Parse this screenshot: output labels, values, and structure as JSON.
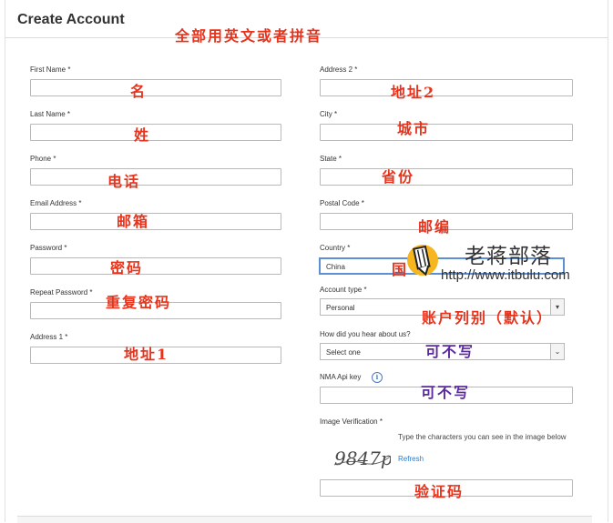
{
  "page": {
    "title": "Create Account"
  },
  "annotations": {
    "top": "全部用英文或者拼音",
    "first_name": "名",
    "last_name": "姓",
    "phone": "电话",
    "email": "邮箱",
    "password": "密码",
    "repeat_password": "重复密码",
    "address1": "地址1",
    "address2": "地址2",
    "city": "城市",
    "state": "省份",
    "postal": "邮编",
    "country": "国",
    "account_type": "账户列别（默认）",
    "hear": "可不写",
    "api_key": "可不写",
    "captcha": "验证码"
  },
  "form": {
    "first_name_label": "First Name *",
    "last_name_label": "Last Name *",
    "phone_label": "Phone *",
    "email_label": "Email Address *",
    "password_label": "Password *",
    "repeat_password_label": "Repeat Password *",
    "address1_label": "Address 1 *",
    "address2_label": "Address 2 *",
    "city_label": "City *",
    "state_label": "State *",
    "postal_label": "Postal Code *",
    "country_label": "Country *",
    "country_value": "China",
    "account_type_label": "Account type *",
    "account_type_value": "Personal",
    "hear_label": "How did you hear about us?",
    "hear_value": "Select one",
    "api_label": "NMA Api key",
    "captcha_label": "Image Verification *",
    "captcha_text": "9847p",
    "captcha_help": "Type the characters you can see in the image below",
    "refresh_label": "Refresh"
  },
  "watermark": {
    "title": "老蒋部落",
    "url": "http://www.itbulu.com"
  },
  "icons": {
    "info": "info-icon",
    "chevron": "chevron-down-icon",
    "logo": "pencil-logo-icon"
  },
  "colors": {
    "annotation_red": "#e8331c",
    "annotation_purple": "#5a2a9c",
    "link": "#2a7bc9",
    "focus": "#5b8fd6"
  }
}
